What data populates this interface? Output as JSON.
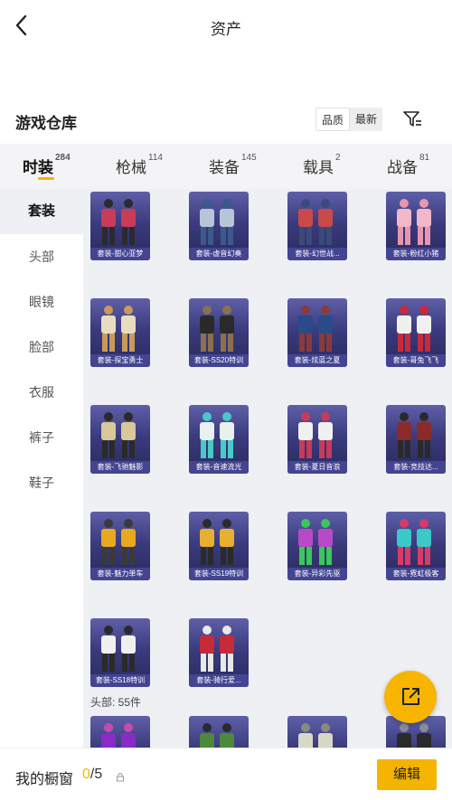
{
  "header": {
    "title": "资产"
  },
  "section": {
    "title": "游戏仓库",
    "sort_options": [
      "品质",
      "最新"
    ]
  },
  "tabs": [
    {
      "label": "时装",
      "count": "284"
    },
    {
      "label": "枪械",
      "count": "114"
    },
    {
      "label": "装备",
      "count": "145"
    },
    {
      "label": "载具",
      "count": "2"
    },
    {
      "label": "战备",
      "count": "81"
    }
  ],
  "sidebar": [
    "套装",
    "头部",
    "眼镜",
    "脸部",
    "衣服",
    "裤子",
    "鞋子"
  ],
  "items": [
    {
      "label": "套装-甜心亚梦",
      "colors": [
        "#c83c5a",
        "#2a2a30"
      ]
    },
    {
      "label": "套装-虚音幻奏",
      "colors": [
        "#b8c4d8",
        "#3b5a8c"
      ]
    },
    {
      "label": "套装-幻世战...",
      "colors": [
        "#c84a4a",
        "#3a4a7a"
      ]
    },
    {
      "label": "套装-粉红小猪",
      "colors": [
        "#f0b8c8",
        "#e896b0"
      ]
    },
    {
      "label": "套装-探宝勇士",
      "colors": [
        "#e8dcc0",
        "#c89a5a"
      ]
    },
    {
      "label": "套装-SS20特训",
      "colors": [
        "#2a2a2a",
        "#8a7050"
      ]
    },
    {
      "label": "套装-炫蓝之夏",
      "colors": [
        "#2a4a8a",
        "#8a3a3a"
      ]
    },
    {
      "label": "套装-哥兔飞飞",
      "colors": [
        "#f0f0f0",
        "#c82a3a"
      ]
    },
    {
      "label": "套装-飞驰魅影",
      "colors": [
        "#d8c89a",
        "#2a2a2a"
      ]
    },
    {
      "label": "套装-音速流光",
      "colors": [
        "#e8f0f0",
        "#4ac8c8"
      ]
    },
    {
      "label": "套装-夏日音浪",
      "colors": [
        "#f0f0f0",
        "#c83a5a"
      ]
    },
    {
      "label": "套装-竞技达...",
      "colors": [
        "#8a2a2a",
        "#2a2a2a"
      ]
    },
    {
      "label": "套装-魅力单车",
      "colors": [
        "#e8a820",
        "#3a3a3a"
      ]
    },
    {
      "label": "套装-SS19特训",
      "colors": [
        "#e8b030",
        "#2a2a2a"
      ]
    },
    {
      "label": "套装-异彩先驱",
      "colors": [
        "#b84ac8",
        "#3ac858"
      ]
    },
    {
      "label": "套装-霓虹极客",
      "colors": [
        "#3ac8c8",
        "#d83a6a"
      ]
    },
    {
      "label": "套装-SS18特训",
      "colors": [
        "#f0f0f0",
        "#2a2a2a"
      ]
    },
    {
      "label": "套装-骑行爱...",
      "colors": [
        "#c82a3a",
        "#e8e8e8"
      ]
    }
  ],
  "head_group": {
    "label": "头部: 55件"
  },
  "head_items": [
    {
      "colors": [
        "#8a2ac8",
        "#c84ab0"
      ]
    },
    {
      "colors": [
        "#4a8a3a",
        "#2a2a2a"
      ]
    },
    {
      "colors": [
        "#d8d8c8",
        "#8a8a7a"
      ]
    },
    {
      "colors": [
        "#2a2a2a",
        "#8a8a9a"
      ]
    }
  ],
  "bottom": {
    "label": "我的橱窗",
    "current": "0",
    "total": "/5",
    "edit": "编辑"
  }
}
